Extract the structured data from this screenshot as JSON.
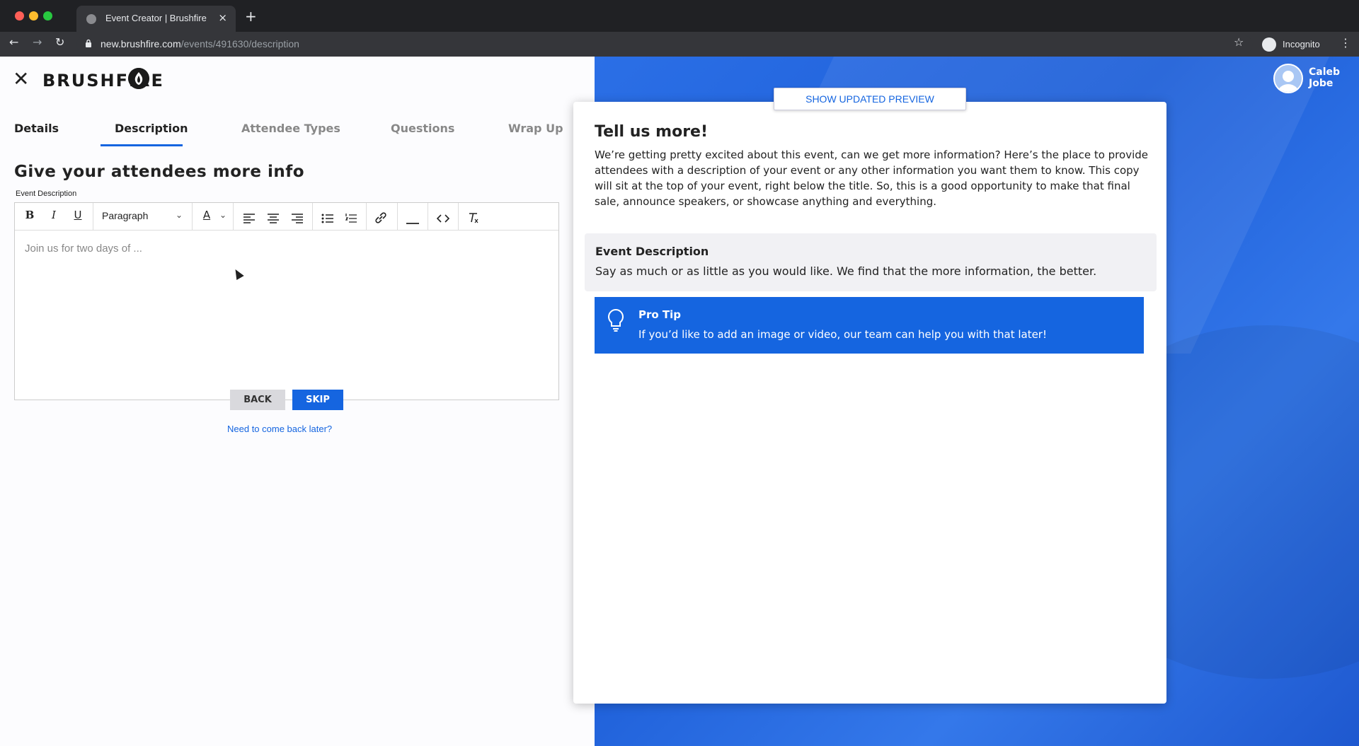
{
  "browser": {
    "tab_title": "Event Creator | Brushfire",
    "tab_close": "×",
    "new_tab": "+",
    "url_host": "new.brushfire.com",
    "url_path": "/events/491630/description",
    "incognito_label": "Incognito"
  },
  "header": {
    "close": "✕",
    "logo": "BRUSHFIRE"
  },
  "steps": [
    {
      "label": "Details"
    },
    {
      "label": "Description"
    },
    {
      "label": "Attendee Types"
    },
    {
      "label": "Questions"
    },
    {
      "label": "Wrap Up"
    }
  ],
  "form": {
    "heading": "Give your attendees more info",
    "field_label": "Event Description",
    "toolbar": {
      "bold": "B",
      "italic": "I",
      "underline": "U",
      "paragraph": "Paragraph",
      "text_color": "A"
    },
    "placeholder": "Join us for two days of ...",
    "back_label": "BACK",
    "skip_label": "SKIP",
    "later_link": "Need to come back later?"
  },
  "preview": {
    "button": "SHOW UPDATED PREVIEW",
    "heading": "Tell us more!",
    "text": "We’re getting pretty excited about this event, can we get more information? Here’s the place to provide attendees with a description of your event or any other information you want them to know. This copy will sit at the top of your event, right below the title. So, this is a good opportunity to make that final sale, announce speakers, or showcase anything and everything.",
    "desc_title": "Event Description",
    "desc_text": "Say as much or as little as you would like. We find that the more information, the better.",
    "tip_title": "Pro Tip",
    "tip_text": "If you’d like to add an image or video, our team can help you with that later!"
  },
  "user": {
    "first": "Caleb",
    "last": "Jobe"
  },
  "colors": {
    "accent": "#1565e0",
    "panel_blue": "#1d5ed8"
  }
}
